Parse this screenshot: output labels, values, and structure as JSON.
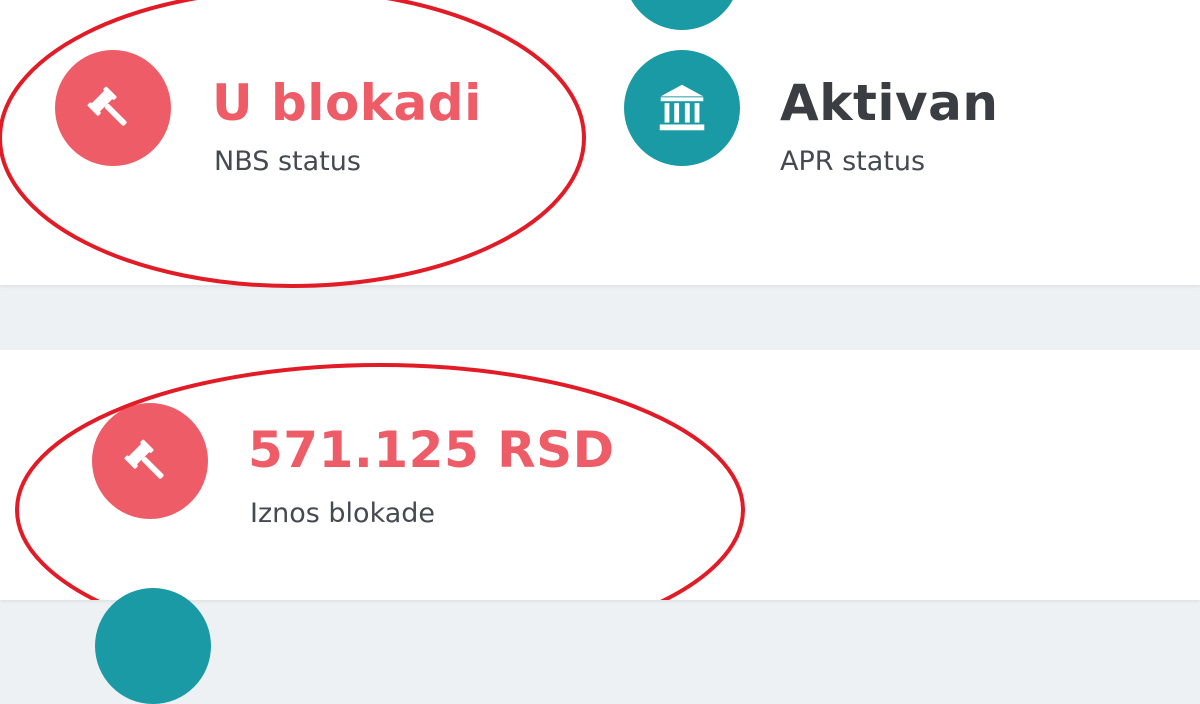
{
  "colors": {
    "danger": "#ee5d67",
    "teal": "#1a9aa5",
    "dark_text": "#3a3d42",
    "annotation": "#e11c26"
  },
  "company_status": {
    "nbs": {
      "value": "U blokadi",
      "label": "NBS status",
      "icon": "gavel-icon"
    },
    "apr": {
      "value": "Aktivan",
      "label": "APR status",
      "icon": "bank-building-icon"
    }
  },
  "blockade": {
    "amount": {
      "value": "571.125 RSD",
      "label": "Iznos blokade",
      "icon": "gavel-icon"
    }
  }
}
